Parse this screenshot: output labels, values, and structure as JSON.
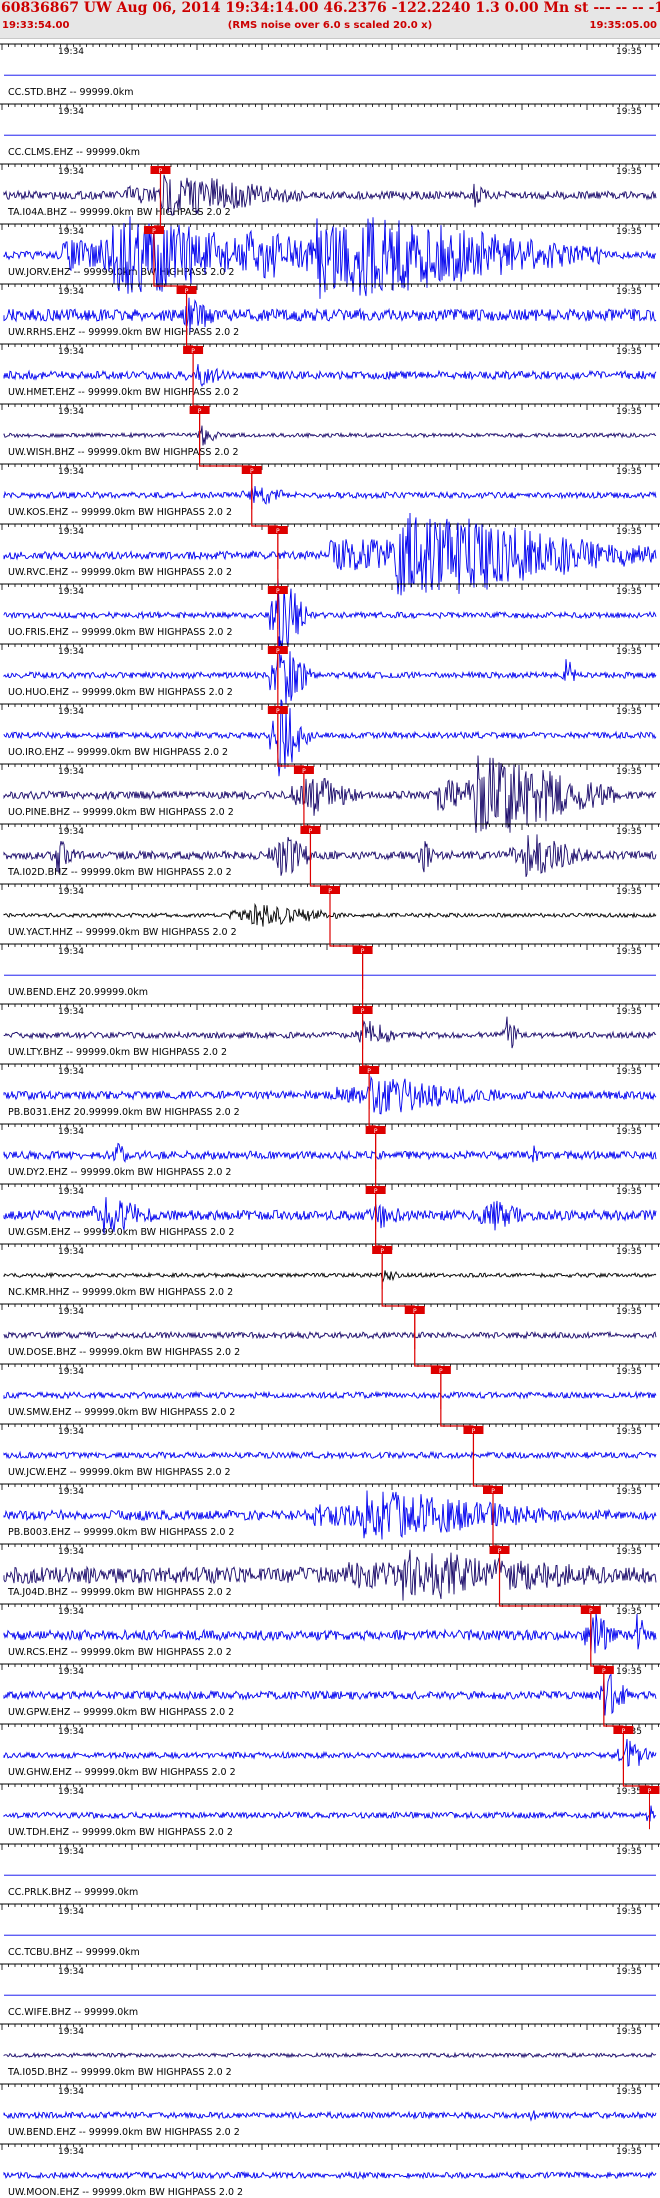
{
  "header": {
    "title": "60836867 UW Aug 06, 2014 19:34:14.00   46.2376 -122.2240  1.3 0.00 Mn st --- -- --  -1",
    "left_time": "19:33:54.00",
    "note": "(RMS noise over 6.0 s scaled 20.0 x)",
    "right_time": "19:35:05.00"
  },
  "colors": {
    "trace_blue": "#0000ee",
    "trace_dark": "#1a0a6a",
    "trace_black": "#000000",
    "pick_red": "#dd0000",
    "header_red": "#cc0000",
    "header_bg": "#e6e6e6"
  },
  "tick_labels": {
    "left": "19:34",
    "right": "19:35"
  },
  "pick_label": "P",
  "traces": [
    {
      "label": "CC.STD.BHZ -- 99999.0km",
      "color": "blue",
      "noise": 0.0,
      "bursts": []
    },
    {
      "label": "CC.CLMS.EHZ -- 99999.0km",
      "color": "blue",
      "noise": 0.0,
      "bursts": []
    },
    {
      "label": "TA.I04A.BHZ -- 99999.0km BW HIGHPASS 2.0 2",
      "color": "dark",
      "noise": 4,
      "pick": 0.24,
      "bursts": [
        [
          0.24,
          0.22,
          18
        ],
        [
          0.72,
          0.02,
          10
        ]
      ]
    },
    {
      "label": "UW.JORV.EHZ -- 99999.0km BW HIGHPASS 2.0 2",
      "color": "blue",
      "noise": 4,
      "pick": 0.23,
      "bursts": [
        [
          0.16,
          0.28,
          40
        ],
        [
          0.48,
          0.44,
          40
        ]
      ]
    },
    {
      "label": "UW.RRHS.EHZ -- 99999.0km BW HIGHPASS 2.0 2",
      "color": "blue",
      "noise": 6,
      "pick": 0.28,
      "bursts": [
        [
          0.28,
          0.05,
          12
        ]
      ]
    },
    {
      "label": "UW.HMET.EHZ -- 99999.0km BW HIGHPASS 2.0 2",
      "color": "blue",
      "noise": 4,
      "pick": 0.29,
      "bursts": [
        [
          0.29,
          0.05,
          8
        ]
      ]
    },
    {
      "label": "UW.WISH.BHZ -- 99999.0km BW HIGHPASS 2.0 2",
      "color": "dark",
      "noise": 2,
      "pick": 0.3,
      "bursts": [
        [
          0.3,
          0.03,
          10
        ]
      ]
    },
    {
      "label": "UW.KOS.EHZ -- 99999.0km BW HIGHPASS 2.0 2",
      "color": "blue",
      "noise": 3,
      "pick": 0.38,
      "bursts": [
        [
          0.38,
          0.06,
          8
        ]
      ]
    },
    {
      "label": "UW.RVC.EHZ -- 99999.0km BW HIGHPASS 2.0 2",
      "color": "blue",
      "noise": 4,
      "pick": 0.42,
      "bursts": [
        [
          0.6,
          0.4,
          40
        ]
      ]
    },
    {
      "label": "UO.FRIS.EHZ -- 99999.0km BW HIGHPASS 2.0 2",
      "color": "blue",
      "noise": 3,
      "pick": 0.42,
      "bursts": [
        [
          0.42,
          0.05,
          40
        ]
      ]
    },
    {
      "label": "UO.HUO.EHZ -- 99999.0km BW HIGHPASS 2.0 2",
      "color": "blue",
      "noise": 3,
      "pick": 0.42,
      "bursts": [
        [
          0.42,
          0.05,
          40
        ],
        [
          0.86,
          0.02,
          15
        ]
      ]
    },
    {
      "label": "UO.IRO.EHZ -- 99999.0km BW HIGHPASS 2.0 2",
      "color": "blue",
      "noise": 3,
      "pick": 0.42,
      "bursts": [
        [
          0.42,
          0.05,
          40
        ]
      ]
    },
    {
      "label": "UO.PINE.BHZ -- 99999.0km BW HIGHPASS 2.0 2",
      "color": "dark",
      "noise": 4,
      "pick": 0.46,
      "bursts": [
        [
          0.46,
          0.08,
          20
        ],
        [
          0.72,
          0.22,
          40
        ]
      ]
    },
    {
      "label": "TA.I02D.BHZ -- 99999.0km BW HIGHPASS 2.0 2",
      "color": "dark",
      "noise": 4,
      "pick": 0.47,
      "bursts": [
        [
          0.08,
          0.03,
          15
        ],
        [
          0.42,
          0.06,
          18
        ],
        [
          0.64,
          0.02,
          20
        ],
        [
          0.8,
          0.1,
          18
        ]
      ]
    },
    {
      "label": "UW.YACT.HHZ -- 99999.0km BW HIGHPASS 2.0 2",
      "color": "black",
      "noise": 2,
      "pick": 0.5,
      "bursts": [
        [
          0.38,
          0.14,
          10
        ]
      ]
    },
    {
      "label": "UW.BEND.EHZ 20.99999.0km",
      "color": "blue",
      "noise": 0.0,
      "pick": 0.55,
      "bursts": []
    },
    {
      "label": "UW.LTY.BHZ -- 99999.0km BW HIGHPASS 2.0 2",
      "color": "dark",
      "noise": 3,
      "pick": 0.55,
      "bursts": [
        [
          0.55,
          0.05,
          15
        ],
        [
          0.77,
          0.02,
          20
        ]
      ]
    },
    {
      "label": "PB.B031.EHZ 20.99999.0km BW HIGHPASS 2.0 2",
      "color": "blue",
      "noise": 4,
      "pick": 0.56,
      "bursts": [
        [
          0.56,
          0.2,
          15
        ]
      ]
    },
    {
      "label": "UW.DY2.EHZ -- 99999.0km BW HIGHPASS 2.0 2",
      "color": "blue",
      "noise": 4,
      "pick": 0.57,
      "bursts": [
        [
          0.17,
          0.02,
          12
        ],
        [
          0.81,
          0.01,
          14
        ]
      ]
    },
    {
      "label": "UW.GSM.EHZ -- 99999.0km BW HIGHPASS 2.0 2",
      "color": "blue",
      "noise": 5,
      "pick": 0.57,
      "bursts": [
        [
          0.15,
          0.08,
          15
        ],
        [
          0.57,
          0.04,
          12
        ],
        [
          0.74,
          0.06,
          12
        ]
      ]
    },
    {
      "label": "NC.KMR.HHZ -- 99999.0km BW HIGHPASS 2.0 2",
      "color": "black",
      "noise": 2,
      "pick": 0.58,
      "bursts": [
        [
          0.58,
          0.03,
          5
        ]
      ]
    },
    {
      "label": "UW.DOSE.BHZ -- 99999.0km BW HIGHPASS 2.0 2",
      "color": "dark",
      "noise": 3,
      "pick": 0.63,
      "bursts": []
    },
    {
      "label": "UW.SMW.EHZ -- 99999.0km BW HIGHPASS 2.0 2",
      "color": "blue",
      "noise": 3,
      "pick": 0.67,
      "bursts": []
    },
    {
      "label": "UW.JCW.EHZ -- 99999.0km BW HIGHPASS 2.0 2",
      "color": "blue",
      "noise": 3,
      "pick": 0.72,
      "bursts": []
    },
    {
      "label": "PB.B003.EHZ -- 99999.0km BW HIGHPASS 2.0 2",
      "color": "blue",
      "noise": 5,
      "pick": 0.75,
      "bursts": [
        [
          0.55,
          0.3,
          20
        ]
      ]
    },
    {
      "label": "TA.J04D.BHZ -- 99999.0km BW HIGHPASS 2.0 2",
      "color": "dark",
      "noise": 8,
      "pick": 0.76,
      "bursts": [
        [
          0.6,
          0.3,
          18
        ]
      ]
    },
    {
      "label": "UW.RCS.EHZ -- 99999.0km BW HIGHPASS 2.0 2",
      "color": "blue",
      "noise": 5,
      "pick": 0.9,
      "bursts": [
        [
          0.9,
          0.04,
          20
        ],
        [
          0.97,
          0.02,
          18
        ]
      ]
    },
    {
      "label": "UW.GPW.EHZ -- 99999.0km BW HIGHPASS 2.0 2",
      "color": "blue",
      "noise": 4,
      "pick": 0.92,
      "bursts": [
        [
          0.92,
          0.04,
          20
        ]
      ]
    },
    {
      "label": "UW.GHW.EHZ -- 99999.0km BW HIGHPASS 2.0 2",
      "color": "blue",
      "noise": 3,
      "pick": 0.95,
      "bursts": [
        [
          0.95,
          0.05,
          15
        ]
      ]
    },
    {
      "label": "UW.TDH.EHZ -- 99999.0km BW HIGHPASS 2.0 2",
      "color": "blue",
      "noise": 3,
      "pick": 0.99,
      "bursts": [
        [
          0.99,
          0.02,
          12
        ]
      ]
    },
    {
      "label": "CC.PRLK.BHZ -- 99999.0km",
      "color": "blue",
      "noise": 0.0,
      "bursts": []
    },
    {
      "label": "CC.TCBU.BHZ -- 99999.0km",
      "color": "blue",
      "noise": 0.0,
      "bursts": []
    },
    {
      "label": "CC.WIFE.BHZ -- 99999.0km",
      "color": "blue",
      "noise": 0.0,
      "bursts": []
    },
    {
      "label": "TA.I05D.BHZ -- 99999.0km BW HIGHPASS 2.0 2",
      "color": "dark",
      "noise": 2,
      "bursts": []
    },
    {
      "label": "UW.BEND.EHZ -- 99999.0km BW HIGHPASS 2.0 2",
      "color": "blue",
      "noise": 3,
      "bursts": [
        [
          0.81,
          0.01,
          10
        ]
      ]
    },
    {
      "label": "UW.MOON.EHZ -- 99999.0km BW HIGHPASS 2.0 2",
      "color": "blue",
      "noise": 3,
      "bursts": []
    }
  ]
}
